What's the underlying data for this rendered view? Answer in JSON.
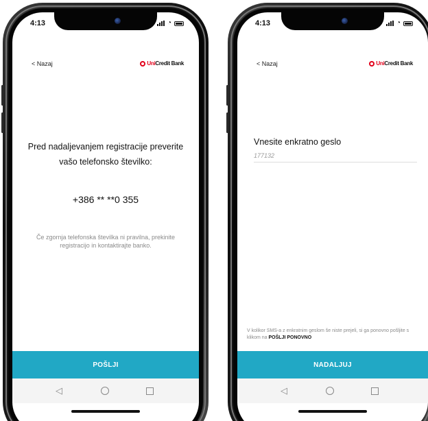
{
  "phones": {
    "left": {
      "status": {
        "time": "4:13"
      },
      "header": {
        "back_label": "< Nazaj",
        "brand_uni": "Uni",
        "brand_rest": "Credit Bank"
      },
      "title": "Pred nadaljevanjem registracije preverite vašo telefonsko številko:",
      "phone_number": "+386 ** **0 355",
      "hint": "Če zgornja telefonska številka ni pravilna, prekinite registracijo in kontaktirajte banko.",
      "button_label": "POŠLJI"
    },
    "right": {
      "status": {
        "time": "4:13"
      },
      "header": {
        "back_label": "< Nazaj",
        "brand_uni": "Uni",
        "brand_rest": "Credit Bank"
      },
      "otp_label": "Vnesite enkratno geslo",
      "otp_value": "177132",
      "resend_note_prefix": "V kolikor SMS-a z enkratnim geslom še niste prejeli, si ga ponovno pošljite s klikom na ",
      "resend_link": "POŠLJI PONOVNO",
      "button_label": "NADALJUJ"
    }
  },
  "colors": {
    "accent": "#21a8c5",
    "brand_red": "#e2001a",
    "hint_gray": "#8a8a8a"
  },
  "icons": {
    "back": "chevron-left-icon",
    "brand": "unicredit-logo-icon",
    "signal": "signal-icon",
    "wifi": "wifi-icon",
    "battery": "battery-icon",
    "nav_back": "triangle-back-icon",
    "nav_home": "circle-home-icon",
    "nav_recent": "square-recent-icon"
  }
}
